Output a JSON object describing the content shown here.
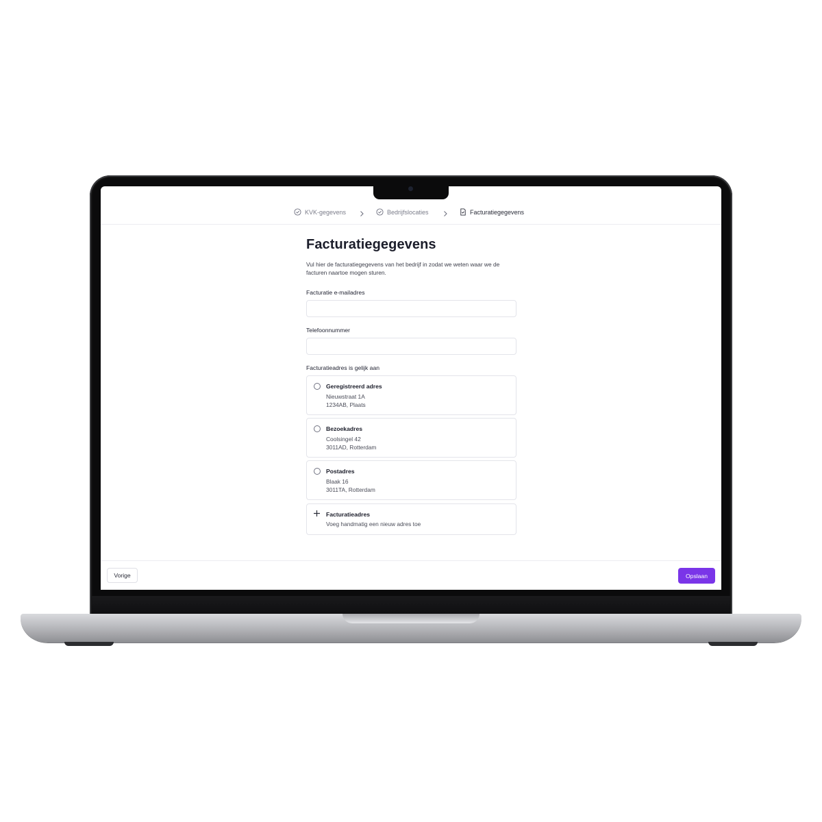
{
  "stepper": {
    "steps": [
      {
        "label": "KVK-gegevens",
        "status": "completed",
        "icon": "check-circle-icon"
      },
      {
        "label": "Bedrijfslocaties",
        "status": "completed",
        "icon": "check-circle-icon"
      },
      {
        "label": "Facturatiegegevens",
        "status": "active",
        "icon": "invoice-icon"
      }
    ],
    "separator_icon": "chevron-right-icon"
  },
  "page": {
    "title": "Facturatiegegevens",
    "intro": "Vul hier de facturatiegegevens van het bedrijf in zodat we weten waar we de facturen naartoe mogen sturen."
  },
  "form": {
    "email": {
      "label": "Facturatie e-mailadres",
      "value": "",
      "placeholder": ""
    },
    "phone": {
      "label": "Telefoonnummer",
      "value": "",
      "placeholder": ""
    },
    "address_choice": {
      "label": "Facturatieadres is gelijk aan",
      "options": [
        {
          "title": "Geregistreerd adres",
          "line1": "Nieuwstraat 1A",
          "line2": "1234AB, Plaats",
          "selected": false
        },
        {
          "title": "Bezoekadres",
          "line1": "Coolsingel 42",
          "line2": "3011AD, Rotterdam",
          "selected": false
        },
        {
          "title": "Postadres",
          "line1": "Blaak 16",
          "line2": "3011TA, Rotterdam",
          "selected": false
        }
      ],
      "add_option": {
        "title": "Facturatieadres",
        "description": "Voeg handmatig een nieuw adres toe",
        "icon": "plus-icon"
      }
    }
  },
  "footer": {
    "previous_label": "Vorige",
    "save_label": "Opslaan"
  },
  "colors": {
    "accent": "#7a35e8",
    "text": "#1b1d2a",
    "border": "#e3e4ea"
  }
}
